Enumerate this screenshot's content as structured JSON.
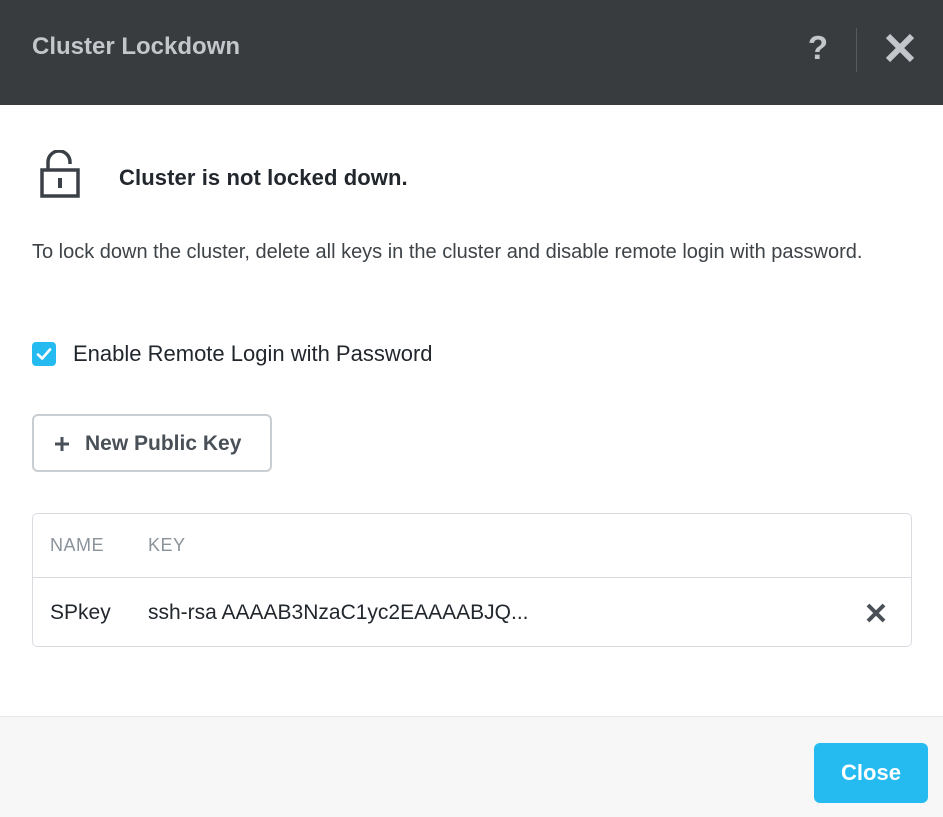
{
  "dialog": {
    "title": "Cluster Lockdown",
    "help_label": "?"
  },
  "status": {
    "icon": "unlock-icon",
    "text": "Cluster is not locked down."
  },
  "description": "To lock down the cluster, delete all keys in the cluster and disable remote login with password.",
  "remote_login": {
    "label": "Enable Remote Login with Password",
    "checked": true
  },
  "new_key_button": {
    "icon": "plus-icon",
    "label": "New Public Key"
  },
  "keys_table": {
    "columns": [
      "NAME",
      "KEY"
    ],
    "rows": [
      {
        "name": "SPkey",
        "key": "ssh-rsa AAAAB3NzaC1yc2EAAAABJQ..."
      }
    ]
  },
  "footer": {
    "close_label": "Close"
  },
  "colors": {
    "header_bg": "#393c3f",
    "accent": "#26bbf0",
    "footer_bg": "#f7f7f7"
  }
}
